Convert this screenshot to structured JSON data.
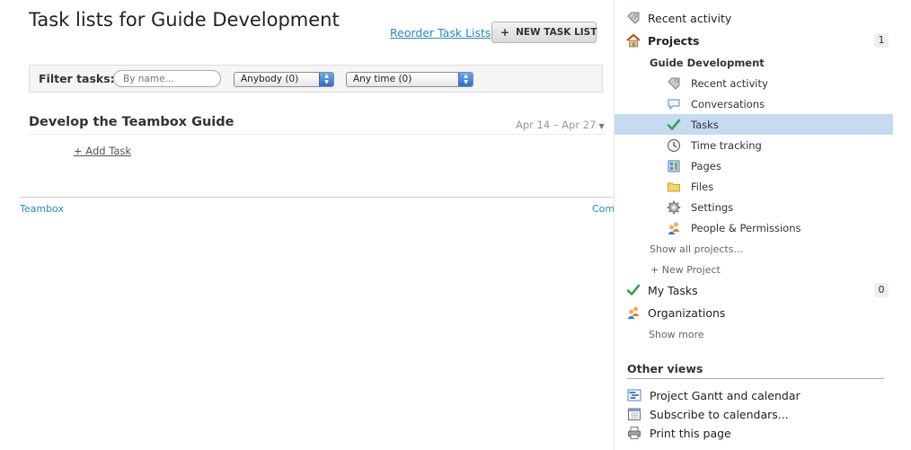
{
  "main": {
    "title": "Task lists for Guide Development",
    "reorder_label": "Reorder Task Lists",
    "new_task_list_label": "NEW TASK LIST",
    "filter": {
      "label": "Filter tasks:",
      "search_placeholder": "By name...",
      "assignee_value": "Anybody (0)",
      "time_value": "Any time (0)"
    },
    "task_list": {
      "title": "Develop the Teambox Guide",
      "dates": "Apr 14 – Apr 27",
      "add_task_label": "+ Add Task"
    },
    "footer": {
      "left_link": "Teambox",
      "right_link": "Com"
    }
  },
  "sidebar": {
    "recent_activity": "Recent activity",
    "projects": {
      "label": "Projects",
      "count": "1"
    },
    "current_project": {
      "name": "Guide Development",
      "items": [
        {
          "label": "Recent activity",
          "icon": "tag-icon"
        },
        {
          "label": "Conversations",
          "icon": "speech-bubble-icon"
        },
        {
          "label": "Tasks",
          "icon": "checkmark-icon",
          "active": true
        },
        {
          "label": "Time tracking",
          "icon": "clock-icon"
        },
        {
          "label": "Pages",
          "icon": "page-icon"
        },
        {
          "label": "Files",
          "icon": "folder-icon"
        },
        {
          "label": "Settings",
          "icon": "gear-icon"
        },
        {
          "label": "People & Permissions",
          "icon": "people-icon"
        }
      ]
    },
    "show_all_projects": "Show all projects...",
    "new_project": "+ New Project",
    "my_tasks": {
      "label": "My Tasks",
      "count": "0"
    },
    "organizations": "Organizations",
    "show_more": "Show more",
    "other_views": {
      "title": "Other views",
      "items": [
        {
          "label": "Project Gantt and calendar",
          "icon": "gantt-icon"
        },
        {
          "label": "Subscribe to calendars...",
          "icon": "calendar-icon"
        },
        {
          "label": "Print this page",
          "icon": "printer-icon"
        }
      ]
    }
  },
  "colors": {
    "link": "#2a8ab5",
    "active_row": "#c6dbf1",
    "check_green": "#3aa24a"
  }
}
